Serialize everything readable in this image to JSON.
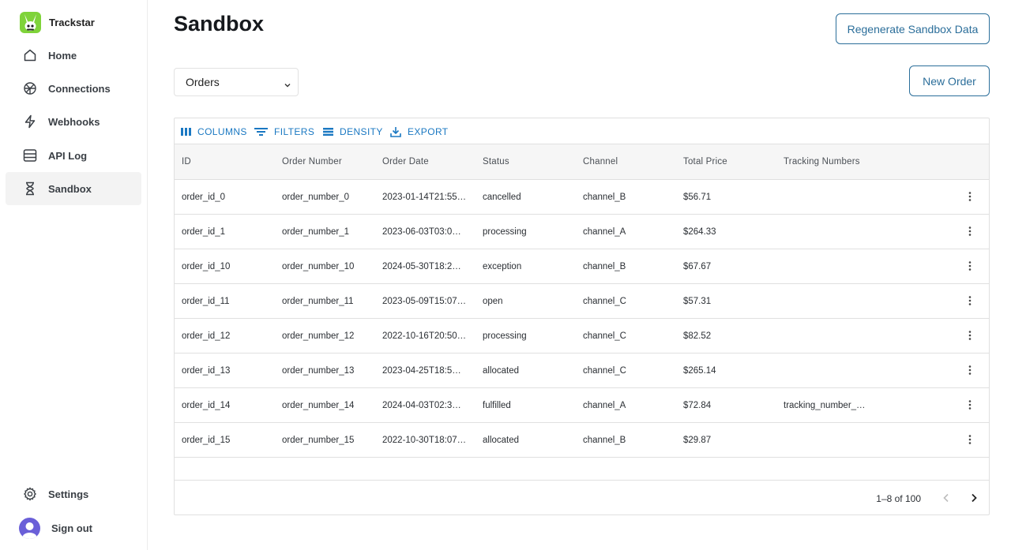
{
  "app": {
    "brand_name": "Trackstar"
  },
  "sidebar": {
    "items": [
      {
        "label": "Home",
        "icon": "home-icon"
      },
      {
        "label": "Connections",
        "icon": "connections-icon"
      },
      {
        "label": "Webhooks",
        "icon": "lightning-icon"
      },
      {
        "label": "API Log",
        "icon": "list-icon"
      },
      {
        "label": "Sandbox",
        "icon": "hourglass-icon",
        "active": true
      }
    ],
    "settings_label": "Settings",
    "signout_label": "Sign out"
  },
  "header": {
    "title": "Sandbox",
    "regenerate_label": "Regenerate Sandbox Data",
    "new_label": "New Order"
  },
  "resource_select": {
    "value": "Orders"
  },
  "toolbar": {
    "columns": "COLUMNS",
    "filters": "FILTERS",
    "density": "DENSITY",
    "export": "EXPORT"
  },
  "table": {
    "columns": [
      "ID",
      "Order Number",
      "Order Date",
      "Status",
      "Channel",
      "Total Price",
      "Tracking Numbers"
    ],
    "rows": [
      [
        "order_id_0",
        "order_number_0",
        "2023-01-14T21:55…",
        "cancelled",
        "channel_B",
        "$56.71",
        ""
      ],
      [
        "order_id_1",
        "order_number_1",
        "2023-06-03T03:0…",
        "processing",
        "channel_A",
        "$264.33",
        ""
      ],
      [
        "order_id_10",
        "order_number_10",
        "2024-05-30T18:2…",
        "exception",
        "channel_B",
        "$67.67",
        ""
      ],
      [
        "order_id_11",
        "order_number_11",
        "2023-05-09T15:07…",
        "open",
        "channel_C",
        "$57.31",
        ""
      ],
      [
        "order_id_12",
        "order_number_12",
        "2022-10-16T20:50…",
        "processing",
        "channel_C",
        "$82.52",
        ""
      ],
      [
        "order_id_13",
        "order_number_13",
        "2023-04-25T18:5…",
        "allocated",
        "channel_C",
        "$265.14",
        ""
      ],
      [
        "order_id_14",
        "order_number_14",
        "2024-04-03T02:3…",
        "fulfilled",
        "channel_A",
        "$72.84",
        "tracking_number_…"
      ],
      [
        "order_id_15",
        "order_number_15",
        "2022-10-30T18:07…",
        "allocated",
        "channel_B",
        "$29.87",
        ""
      ]
    ]
  },
  "pagination": {
    "label": "1–8 of 100"
  },
  "colors": {
    "accent": "#1a78c2",
    "button_border": "#2b6e9a",
    "logo": "#7fd33a",
    "avatar": "#6a5fd8"
  }
}
